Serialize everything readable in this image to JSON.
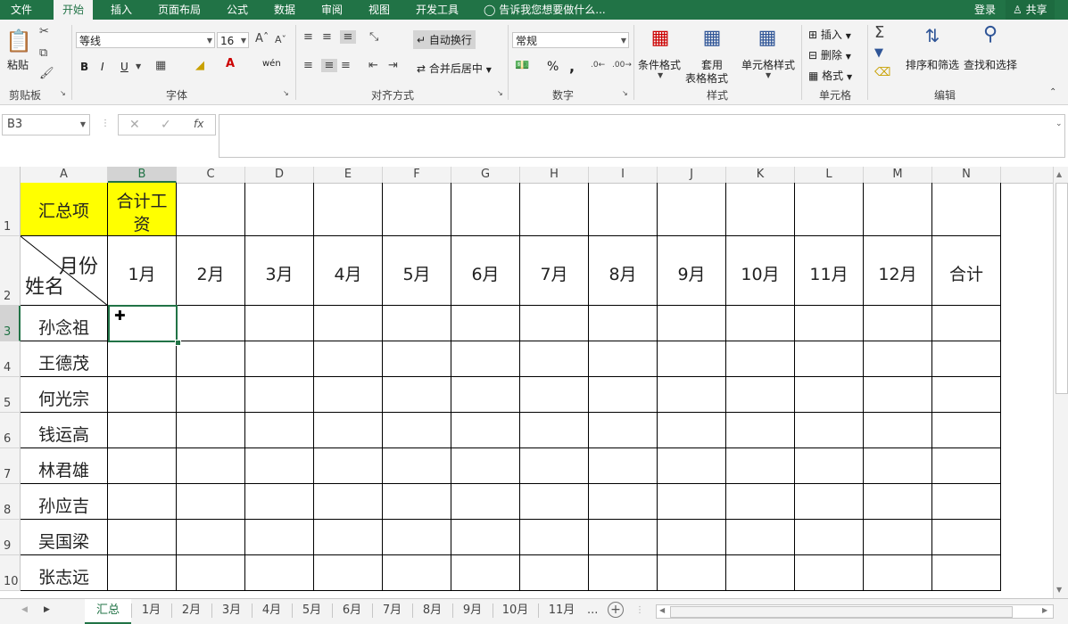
{
  "menu": {
    "items": [
      {
        "label": "文件",
        "active": false
      },
      {
        "label": "开始",
        "active": true
      },
      {
        "label": "插入",
        "active": false
      },
      {
        "label": "页面布局",
        "active": false
      },
      {
        "label": "公式",
        "active": false
      },
      {
        "label": "数据",
        "active": false
      },
      {
        "label": "审阅",
        "active": false
      },
      {
        "label": "视图",
        "active": false
      },
      {
        "label": "开发工具",
        "active": false
      }
    ],
    "tell_me": "告诉我您想要做什么...",
    "login": "登录",
    "share": "共享"
  },
  "ribbon": {
    "clipboard": {
      "paste": "粘贴",
      "label": "剪贴板"
    },
    "font": {
      "name": "等线",
      "size": "16",
      "bold": "B",
      "italic": "I",
      "underline": "U",
      "phonetic": "wén",
      "label": "字体"
    },
    "alignment": {
      "wrap": "自动换行",
      "merge": "合并后居中",
      "label": "对齐方式"
    },
    "number": {
      "format": "常规",
      "percent": "%",
      "comma": ",",
      "label": "数字"
    },
    "styles": {
      "conditional": "条件格式",
      "table_line1": "套用",
      "table_line2": "表格格式",
      "cell_styles": "单元格样式",
      "label": "样式"
    },
    "cells": {
      "insert": "插入",
      "delete": "删除",
      "format": "格式",
      "label": "单元格"
    },
    "editing": {
      "sort": "排序和筛选",
      "find": "查找和选择",
      "label": "编辑"
    }
  },
  "formula_bar": {
    "name_box": "B3",
    "fx": "fx",
    "value": ""
  },
  "columns": [
    "A",
    "B",
    "C",
    "D",
    "E",
    "F",
    "G",
    "H",
    "I",
    "J",
    "K",
    "L",
    "M",
    "N"
  ],
  "selected_column": "B",
  "rows": [
    "1",
    "2",
    "3",
    "4",
    "5",
    "6",
    "7",
    "8",
    "9",
    "10"
  ],
  "selected_row": "3",
  "sheet": {
    "row1": {
      "a1": "汇总项",
      "b1_line1": "合计工",
      "b1_line2": "资"
    },
    "row2": {
      "diag_top": "月份",
      "diag_bottom": "姓名",
      "months": [
        "1月",
        "2月",
        "3月",
        "4月",
        "5月",
        "6月",
        "7月",
        "8月",
        "9月",
        "10月",
        "11月",
        "12月",
        "合计"
      ]
    },
    "names": [
      "孙念祖",
      "王德茂",
      "何光宗",
      "钱运高",
      "林君雄",
      "孙应吉",
      "吴国梁",
      "张志远"
    ]
  },
  "tabs": {
    "items": [
      "汇总",
      "1月",
      "2月",
      "3月",
      "4月",
      "5月",
      "6月",
      "7月",
      "8月",
      "9月",
      "10月",
      "11月"
    ],
    "active": "汇总",
    "more": "..."
  },
  "colors": {
    "accent": "#217346",
    "highlight": "#ffff00"
  }
}
